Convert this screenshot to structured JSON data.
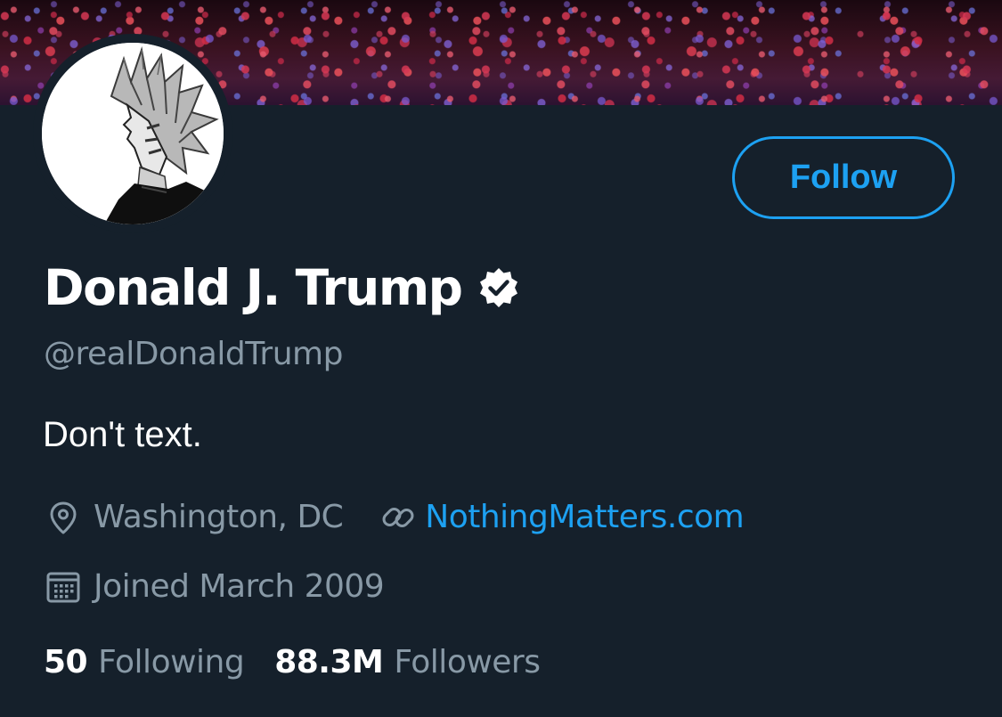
{
  "profile": {
    "display_name": "Donald J. Trump",
    "handle": "@realDonaldTrump",
    "bio": "Don't text.",
    "verified": true,
    "location": "Washington, DC",
    "website": "NothingMatters.com",
    "joined": "Joined March 2009",
    "follow_label": "Follow"
  },
  "stats": [
    {
      "count": "50",
      "label": "Following"
    },
    {
      "count": "88.3M",
      "label": "Followers"
    }
  ],
  "icons": {
    "location": "location-pin-icon",
    "link": "link-icon",
    "calendar": "calendar-icon",
    "verified": "verified-badge-icon"
  },
  "colors": {
    "background": "#15202b",
    "accent": "#1da1f2",
    "secondary_text": "#8899a6",
    "primary_text": "#ffffff"
  }
}
